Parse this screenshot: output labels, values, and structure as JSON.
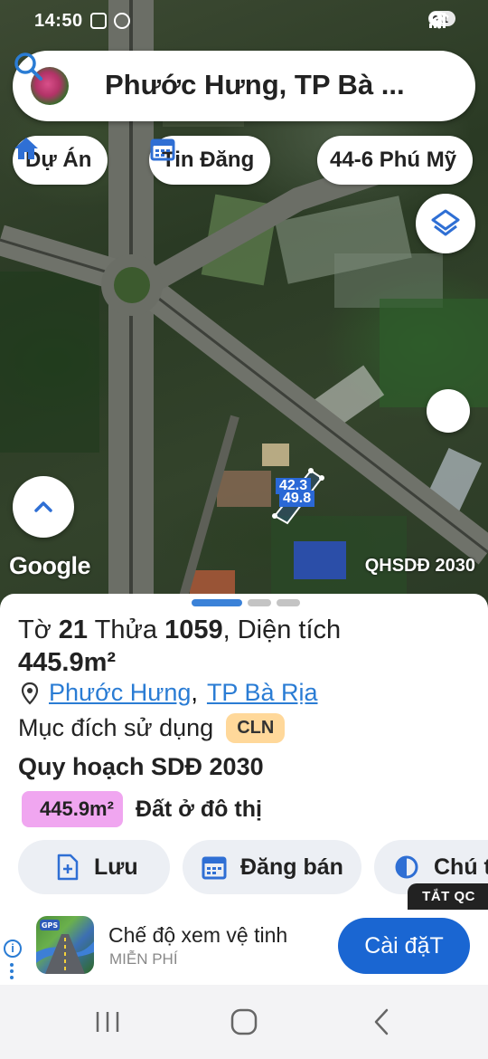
{
  "status_bar": {
    "time": "14:50",
    "battery": "51"
  },
  "search": {
    "query": "Phước Hưng, TP Bà ..."
  },
  "chips": [
    {
      "label": "Dự Án",
      "icon": "home-icon"
    },
    {
      "label": "Tin Đăng",
      "icon": "calendar-icon"
    },
    {
      "label": "44-6 Phú Mỹ",
      "icon": ""
    }
  ],
  "map": {
    "parcel_edge_labels": [
      "42.3",
      "49.8"
    ],
    "attribution": "Google",
    "mode_label": "QHSDĐ 2030"
  },
  "parcel": {
    "sheet_prefix": "Tờ",
    "sheet_number": "21",
    "lot_prefix": "Thửa",
    "lot_number": "1059",
    "area_prefix": ", Diện tích",
    "area_value": "445.9m²",
    "ward": "Phước Hưng",
    "separator": ",",
    "city": "TP Bà Rịa",
    "purpose_label": "Mục đích sử dụng",
    "purpose_code": "CLN",
    "plan_title": "Quy hoạch SDĐ 2030",
    "plan_area": "445.9m²",
    "plan_use": "Đất ở đô thị",
    "plan_color": "#f0a6f0"
  },
  "actions": [
    {
      "label": "Lưu",
      "icon": "add-file-icon"
    },
    {
      "label": "Đăng bán",
      "icon": "calendar-icon"
    },
    {
      "label": "Chú t",
      "icon": "contrast-icon"
    }
  ],
  "ad": {
    "close_label": "TẮT QC",
    "info_label": "i",
    "icon_text": "GPS",
    "title": "Chế độ xem vệ tinh",
    "subtitle": "MIỄN PHÍ",
    "cta": "Cài đặT"
  },
  "colors": {
    "accent": "#1a66d2",
    "link": "#2a7cd4",
    "badge": "#ffd89a"
  }
}
